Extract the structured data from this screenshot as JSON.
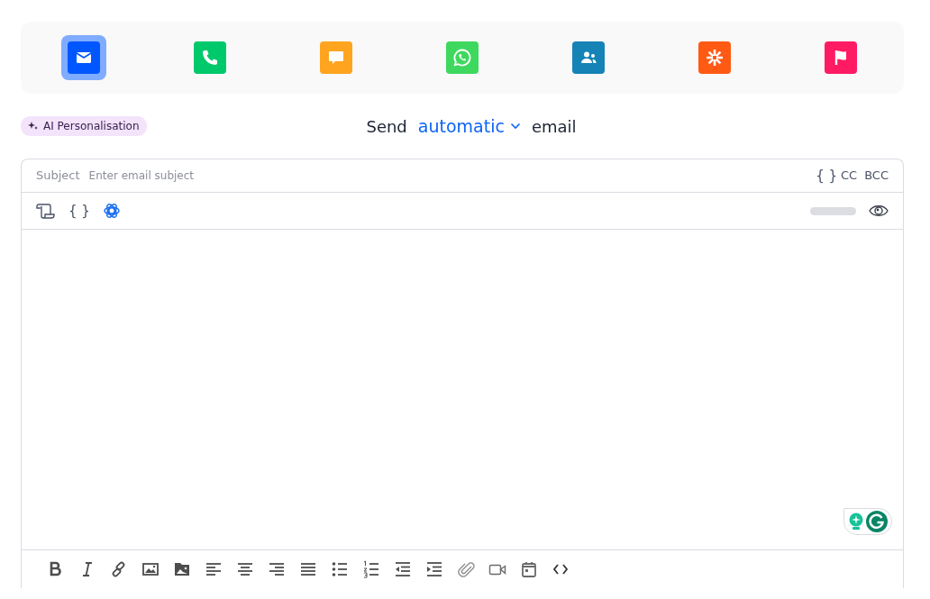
{
  "channels": [
    {
      "kind": "email",
      "color": "#0057ff",
      "selected": true
    },
    {
      "kind": "call",
      "color": "#00c96b",
      "selected": false
    },
    {
      "kind": "sms",
      "color": "#ffa41f",
      "selected": false
    },
    {
      "kind": "whatsapp",
      "color": "#3fd85f",
      "selected": false
    },
    {
      "kind": "linkedin",
      "color": "#1583b5",
      "selected": false
    },
    {
      "kind": "zapier",
      "color": "#ff5a14",
      "selected": false
    },
    {
      "kind": "task",
      "color": "#ff1b64",
      "selected": false
    }
  ],
  "ai_badge": "AI Personalisation",
  "send_line": {
    "prefix": "Send",
    "mode": "automatic",
    "suffix": "email"
  },
  "subject": {
    "label": "Subject",
    "placeholder": "Enter email subject",
    "variables": "{ }",
    "cc": "CC",
    "bcc": "BCC"
  },
  "editor_toolbar": {
    "variables": "{ }"
  }
}
